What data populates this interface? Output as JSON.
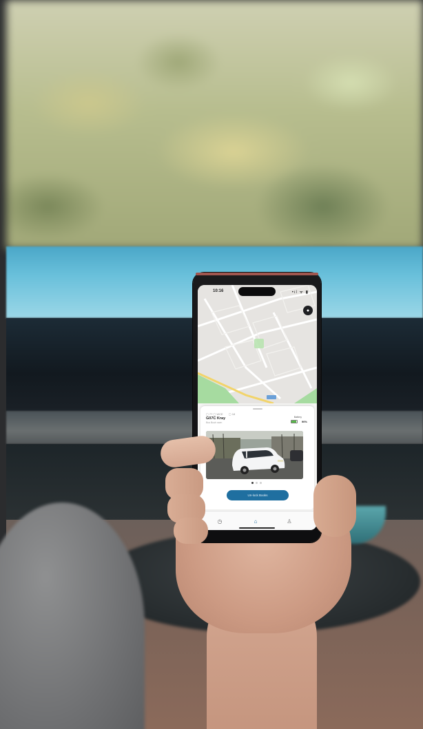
{
  "phone": {
    "status": {
      "time": "10:16",
      "icons": "•ıl ᯤ ▮"
    },
    "map": {
      "profile_icon": "profile-icon"
    },
    "vehicle": {
      "meta": [
        "▢ 77 ▢ WCE",
        "▢ 18"
      ],
      "title": "G07C Kray",
      "subtitle": "Bus Bush ssen",
      "battery_label": "Battery",
      "battery_percent": "90%",
      "battery_level": 0.9
    },
    "carousel": {
      "pages": 3,
      "active": 0
    },
    "cta_label": "Un-lock Books",
    "tabs": [
      {
        "icon": "history-icon",
        "glyph": "◷"
      },
      {
        "icon": "home-icon",
        "glyph": "⌂"
      },
      {
        "icon": "user-icon",
        "glyph": "♙"
      }
    ]
  },
  "colors": {
    "accent": "#1f6fa0",
    "battery": "#59b84a",
    "map_green": "#9fd89a",
    "map_road_yellow": "#f2d46a"
  }
}
